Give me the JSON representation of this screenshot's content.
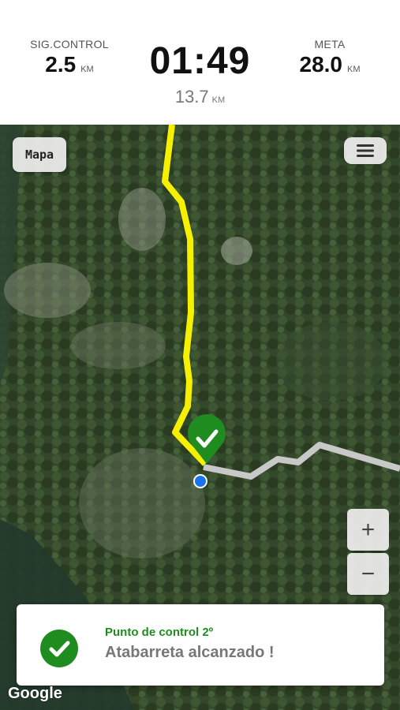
{
  "stats": {
    "next_control": {
      "label": "SIG.CONTROL",
      "value": "2.5",
      "unit": "KM"
    },
    "goal": {
      "label": "META",
      "value": "28.0",
      "unit": "KM"
    },
    "timer": "01:49",
    "distance": {
      "value": "13.7",
      "unit": "KM"
    }
  },
  "map": {
    "map_button_label": "Mapa",
    "zoom_in_label": "+",
    "zoom_out_label": "−",
    "attribution": "Google",
    "route_color": "#f5f000",
    "path_color": "#c8c8c8",
    "checkpoint_color": "#1f8c1f",
    "location_color": "#1a73e8"
  },
  "toast": {
    "title": "Punto de control 2º",
    "message": "Atabarreta alcanzado !"
  }
}
